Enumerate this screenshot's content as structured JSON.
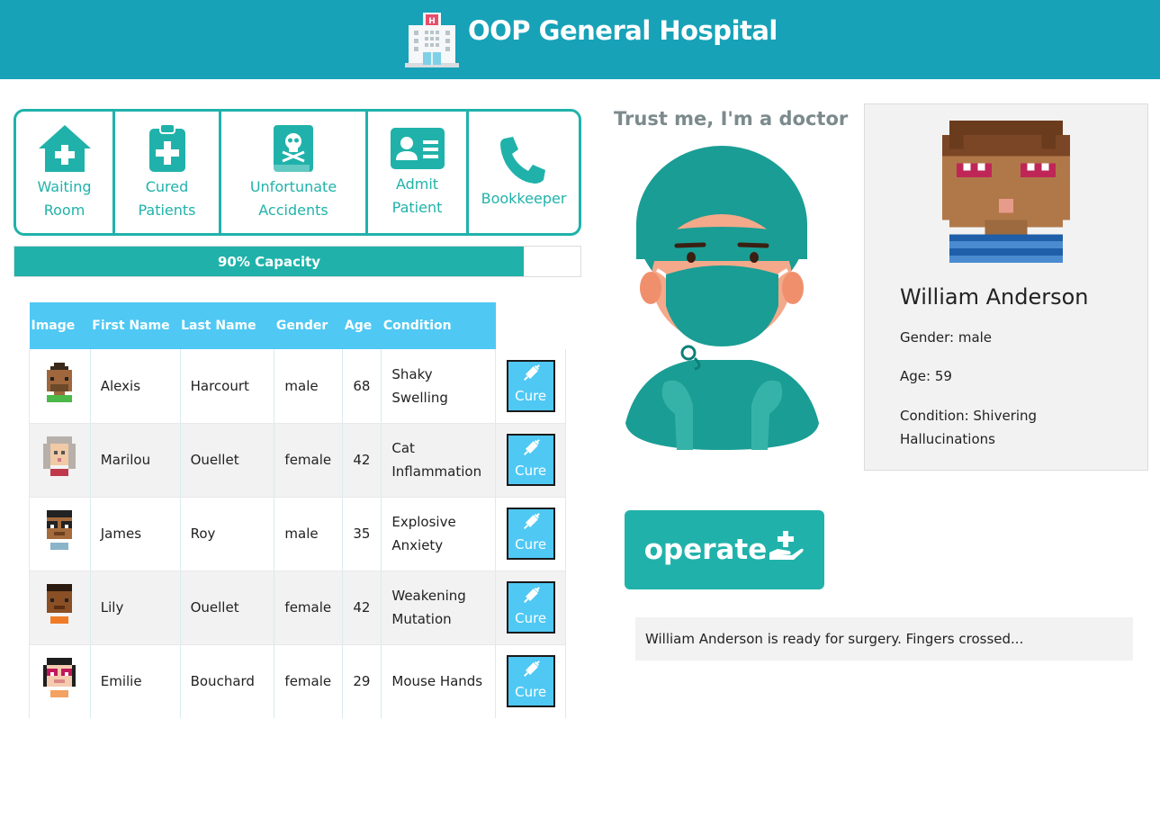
{
  "header": {
    "title": "OOP General Hospital",
    "logo_icon": "hospital-icon"
  },
  "nav": {
    "items": [
      {
        "line1": "Waiting",
        "line2": "Room",
        "icon": "house-plus-icon"
      },
      {
        "line1": "Cured",
        "line2": "Patients",
        "icon": "clipboard-plus-icon"
      },
      {
        "line1": "Unfortunate",
        "line2": "Accidents",
        "icon": "skull-book-icon"
      },
      {
        "line1": "Admit",
        "line2": "Patient",
        "icon": "id-card-icon"
      },
      {
        "line1": "Bookkeeper",
        "line2": "",
        "icon": "phone-icon"
      }
    ]
  },
  "capacity": {
    "label": "90% Capacity",
    "percent": 90
  },
  "table": {
    "headers": [
      "Image",
      "First Name",
      "Last Name",
      "Gender",
      "Age",
      "Condition"
    ],
    "action_label": "Cure",
    "rows": [
      {
        "first": "Alexis",
        "last": "Harcourt",
        "gender": "male",
        "age": "68",
        "cond1": "Shaky",
        "cond2": "Swelling"
      },
      {
        "first": "Marilou",
        "last": "Ouellet",
        "gender": "female",
        "age": "42",
        "cond1": "Cat",
        "cond2": "Inflammation"
      },
      {
        "first": "James",
        "last": "Roy",
        "gender": "male",
        "age": "35",
        "cond1": "Explosive",
        "cond2": "Anxiety"
      },
      {
        "first": "Lily",
        "last": "Ouellet",
        "gender": "female",
        "age": "42",
        "cond1": "Weakening",
        "cond2": "Mutation"
      },
      {
        "first": "Emilie",
        "last": "Bouchard",
        "gender": "female",
        "age": "29",
        "cond1": "Mouse Hands",
        "cond2": ""
      }
    ]
  },
  "doctor": {
    "tagline": "Trust me, I'm a doctor"
  },
  "patient_card": {
    "name": "William Anderson",
    "gender": "Gender: male",
    "age": "Age: 59",
    "condition1": "Condition: Shivering",
    "condition2": "Hallucinations"
  },
  "operate": {
    "label": "operate",
    "icon": "hand-plus-icon"
  },
  "status_message": "William Anderson is ready for surgery. Fingers crossed...",
  "colors": {
    "header": "#17a2b8",
    "accent": "#20b2aa",
    "table_header": "#4fc8f4"
  }
}
